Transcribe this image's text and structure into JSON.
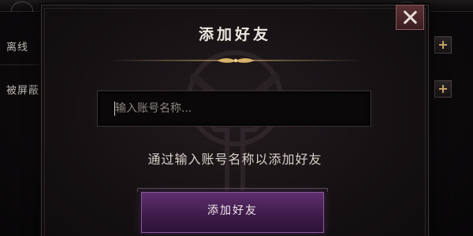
{
  "background": {
    "rows": [
      {
        "label": "离线"
      },
      {
        "label": "被屏蔽"
      }
    ],
    "add_icon": "plus-icon"
  },
  "dialog": {
    "title": "添加好友",
    "close_icon": "close-icon",
    "input": {
      "value": "",
      "placeholder": "输入账号名称..."
    },
    "hint": "通过输入账号名称以添加好友",
    "submit_label": "添加好友"
  },
  "colors": {
    "accent_purple": "#5e2f6d",
    "close_red": "#5a3134",
    "gold": "#c9a46a",
    "text": "#ece6df"
  }
}
